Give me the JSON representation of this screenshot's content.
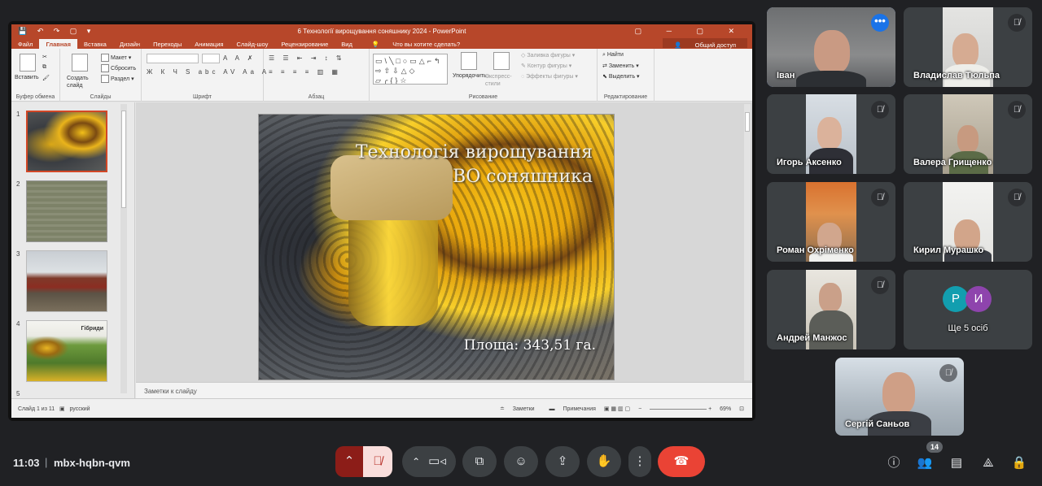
{
  "powerpoint": {
    "window_title": "6 Технології вирощування соняшнику 2024 - PowerPoint",
    "tabs": [
      "Файл",
      "Главная",
      "Вставка",
      "Дизайн",
      "Переходы",
      "Анимация",
      "Слайд-шоу",
      "Рецензирование",
      "Вид"
    ],
    "active_tab": "Главная",
    "tell_me": "Что вы хотите сделать?",
    "share_label": "Общий доступ",
    "ribbon": {
      "paste": "Вставить",
      "new_slide": "Создать слайд",
      "layout": "Макет",
      "reset": "Сбросить",
      "section": "Раздел",
      "arrange": "Упорядочить",
      "quick_styles": "Экспресс-стили",
      "shape_fill": "Заливка фигуры",
      "shape_outline": "Контур фигуры",
      "shape_effects": "Эффекты фигуры",
      "find": "Найти",
      "replace": "Заменить",
      "select": "Выделить",
      "groups": {
        "clipboard": "Буфер обмена",
        "slides": "Слайды",
        "font": "Шрифт",
        "paragraph": "Абзац",
        "drawing": "Рисование",
        "editing": "Редактирование"
      }
    },
    "thumbnails": [
      {
        "num": "1"
      },
      {
        "num": "2"
      },
      {
        "num": "3"
      },
      {
        "num": "4",
        "label": "Гібриди"
      },
      {
        "num": "5"
      }
    ],
    "slide": {
      "title_line1": "Технологія вирощування",
      "title_line2": "ВО соняшника",
      "area": "Площа: 343,51 га."
    },
    "notes_placeholder": "Заметки к слайду",
    "status": {
      "slide_info": "Слайд 1 из 11",
      "language": "русский",
      "notes_btn": "Заметки",
      "comments_btn": "Примечания",
      "zoom": "69%"
    }
  },
  "participants": [
    {
      "name": "Іван",
      "muted": false,
      "speaking": true
    },
    {
      "name": "Владислав Тюльпа",
      "muted": true
    },
    {
      "name": "Игорь Аксенко",
      "muted": true
    },
    {
      "name": "Валера Грищенко",
      "muted": true
    },
    {
      "name": "Роман Охріменко",
      "muted": true
    },
    {
      "name": "Кирил Мурашко",
      "muted": true
    },
    {
      "name": "Андрей Манжос",
      "muted": true
    },
    {
      "name": "Ще 5 осіб",
      "initials": [
        "Р",
        "И"
      ],
      "colors": [
        "#129eaf",
        "#8e44ad"
      ]
    },
    {
      "name": "Сергій Саньов",
      "muted": true
    }
  ],
  "meeting": {
    "time": "11:03",
    "code": "mbx-hqbn-qvm",
    "people_count": "14"
  },
  "colors": {
    "ppt_accent": "#b7472a",
    "end_call": "#ea4335",
    "mic_off": "#f9dedc",
    "highlight": "#8ab4f8"
  }
}
